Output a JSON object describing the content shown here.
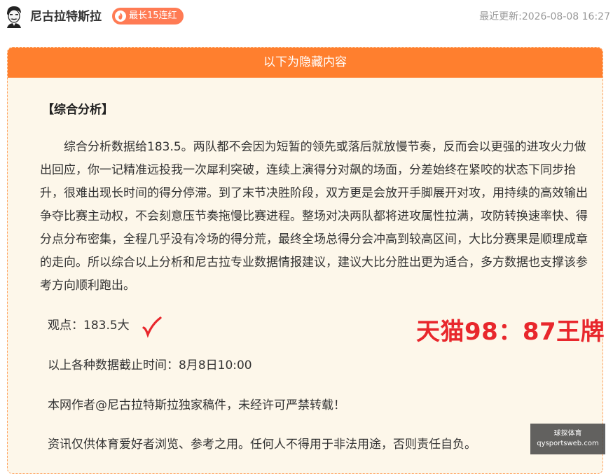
{
  "header": {
    "author_name": "尼古拉特斯拉",
    "badge_label": "最长15连红",
    "update_label": "最近更新:",
    "update_time": "2026-08-08 16:27"
  },
  "card": {
    "banner_text": "以下为隐藏内容",
    "section_title": "【综合分析】",
    "analysis_paragraph": "综合分析数据给183.5。两队都不会因为短暂的领先或落后就放慢节奏，反而会以更强的进攻火力做出回应，你一记精准远投我一次犀利突破，连续上演得分对飙的场面，分差始终在紧咬的状态下同步抬升，很难出现长时间的得分停滞。到了末节决胜阶段，双方更是会放开手脚展开对攻，用持续的高效输出争夺比赛主动权，不会刻意压节奏拖慢比赛进程。整场对决两队都将进攻属性拉满，攻防转换速率快、得分点分布密集，全程几乎没有冷场的得分荒，最终全场总得分会冲高到较高区间，大比分赛果是顺理成章的走向。所以综合以上分析和尼古拉专业数据情报建议，建议大比分胜出更为适合，多方数据也支撑该参考方向顺利跑出。",
    "viewpoint": "观点：183.5大",
    "result_stamp": "天猫98：87王牌",
    "cutoff": "以上各种数据截止时间：8月8日10:00",
    "copyright": "本网作者@尼古拉特斯拉独家稿件，未经许可严禁转载！",
    "disclaimer": "资讯仅供体育爱好者浏览、参考之用。任何人不得用于非法用途，否则责任自负。"
  },
  "watermark": {
    "line1": "球探体育",
    "line2": "qysportsweb.com"
  },
  "colors": {
    "accent": "#ff7f2e",
    "badge": "#ff7b54",
    "card_bg": "#fdf7ea",
    "stamp_red": "#e8272c",
    "check_red": "#e8272c"
  },
  "icons": {
    "avatar": "avatar-icon",
    "flame": "flame-icon",
    "check": "check-mark-icon"
  }
}
